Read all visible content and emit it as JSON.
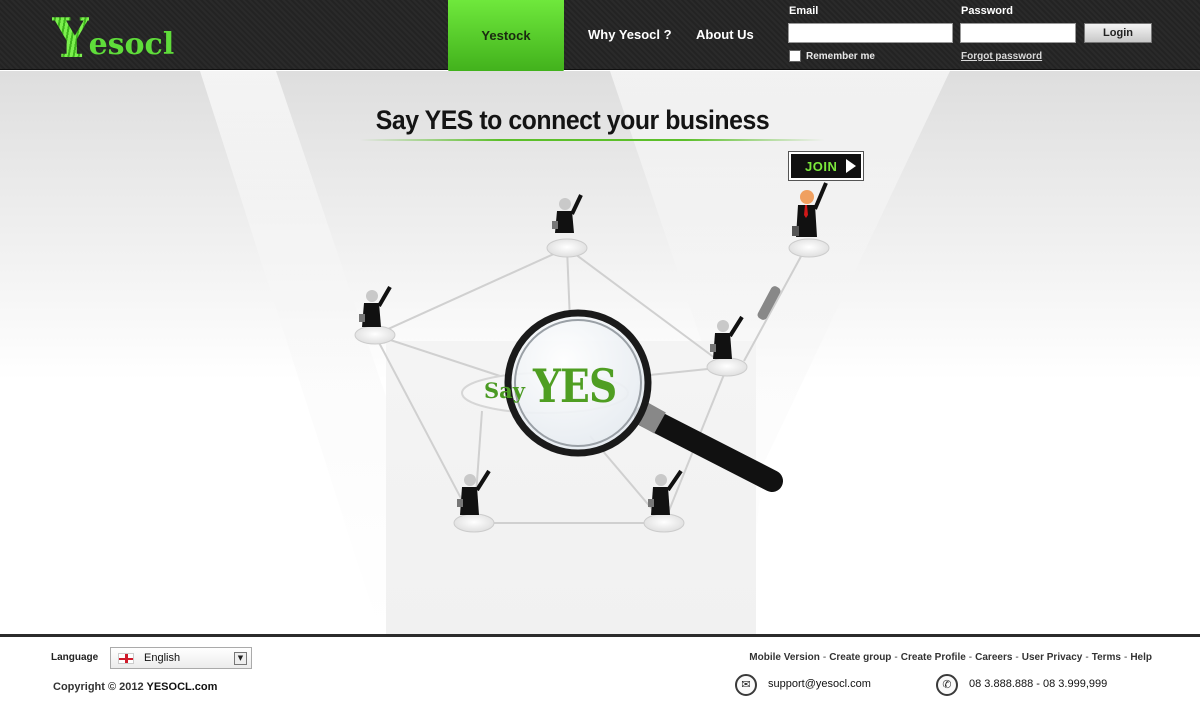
{
  "header": {
    "logo_initial": "Y",
    "logo_rest": "esocl",
    "nav": [
      {
        "label": "Yestock",
        "active": true
      },
      {
        "label": "Why Yesocl ?"
      },
      {
        "label": "About Us"
      }
    ],
    "login": {
      "email_label": "Email",
      "password_label": "Password",
      "email_value": "",
      "password_value": "",
      "login_button": "Login",
      "remember_label": "Remember me",
      "forgot_link": "Forgot password"
    }
  },
  "hero": {
    "headline": "Say YES to connect your business",
    "join_label": "JOIN",
    "badge_say": "Say",
    "badge_yes": "YES"
  },
  "footer": {
    "language_label": "Language",
    "language_value": "English",
    "copyright_prefix": "Copyright © 2012",
    "copyright_brand": "YESOCL.com",
    "links": [
      "Mobile Version",
      "Create group",
      "Create Profile",
      "Careers",
      "User Privacy",
      "Terms",
      "Help"
    ],
    "email": "support@yesocl.com",
    "phone": "08 3.888.888 - 08 3.999,999"
  },
  "colors": {
    "accent_green": "#5cbf2a",
    "header_bg": "#262626",
    "join_green": "#7ce83c"
  },
  "icons": {
    "mail": "mail-icon",
    "phone": "phone-icon",
    "flag": "england-flag-icon",
    "magnifier": "magnifier-icon"
  }
}
